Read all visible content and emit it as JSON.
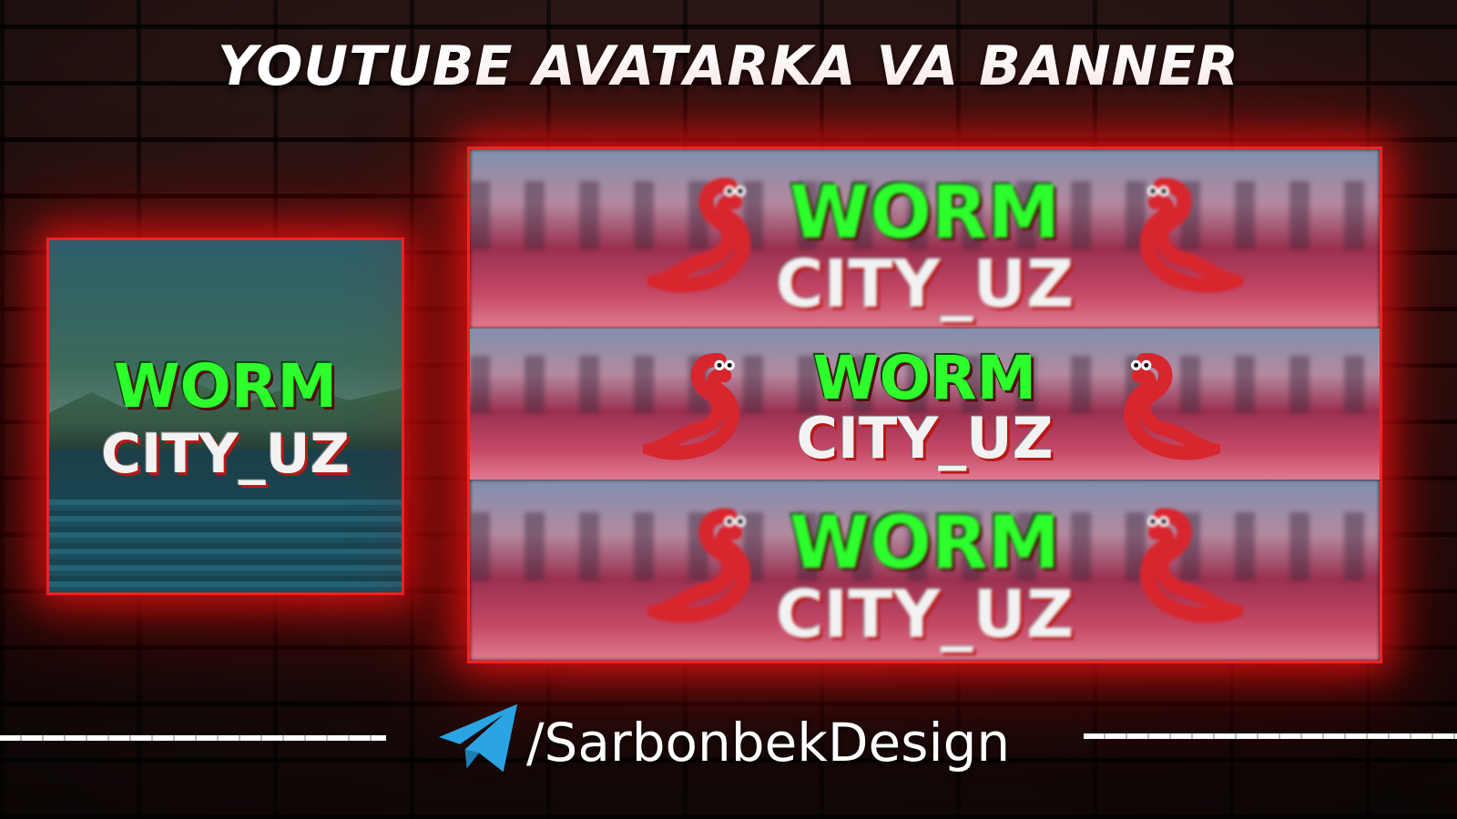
{
  "heading": "YOUTUBE AVATARKA VA BANNER",
  "avatar": {
    "line1": "WORM",
    "line2": "CITY_UZ"
  },
  "banners": [
    {
      "line1": "WORM",
      "line2": "CITY_UZ"
    },
    {
      "line1": "WORM",
      "line2": "CITY_UZ"
    },
    {
      "line1": "WORM",
      "line2": "CITY_UZ"
    }
  ],
  "footer": {
    "handle": "/SarbonbekDesign",
    "icon": "telegram-icon"
  },
  "colors": {
    "glow": "#ff1a1a",
    "logo_green": "#2dff2d",
    "logo_white": "#f2f2f2",
    "worm_red": "#d8262e"
  }
}
